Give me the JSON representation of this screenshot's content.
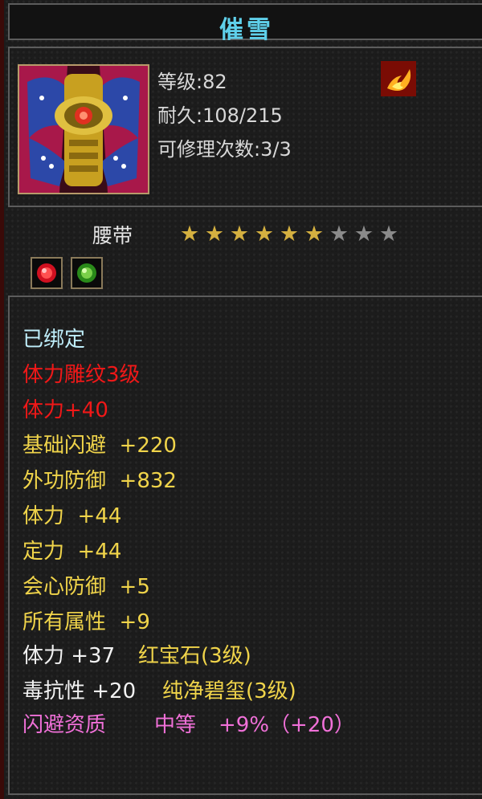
{
  "item": {
    "name": "催雪",
    "level_text": "等级:82",
    "durability_text": "耐久:108/215",
    "repair_text": "可修理次数:3/3",
    "type": "腰带",
    "stars_filled": 6,
    "stars_total": 9
  },
  "icons": {
    "item": "belt-icon",
    "badge": "fire-icon",
    "gems": [
      "red-gem-icon",
      "green-gem-icon"
    ]
  },
  "attributes": {
    "bound": "已绑定",
    "engrave": "体力雕纹3级",
    "engrave_bonus": "体力+40",
    "base_dodge": "基础闪避  +220",
    "outer_defense": "外功防御  +832",
    "stamina": "体力  +44",
    "concentration": "定力  +44",
    "crit_defense": "会心防御  +5",
    "all_attributes": "所有属性  +9",
    "gem1_stat": "体力 +37",
    "gem1_name": "红宝石(3级)",
    "gem2_stat": "毒抗性 +20",
    "gem2_name": "纯净碧玺(3级)",
    "aptitude_label": "闪避资质",
    "aptitude_grade": "中等",
    "aptitude_bonus": "+9%（+20）"
  },
  "colors": {
    "title": "#5fd0ea",
    "bound": "#bfeefa",
    "red": "#f01818",
    "yellow": "#f0d44a",
    "white": "#f2f2f2",
    "pink": "#f070d8"
  }
}
